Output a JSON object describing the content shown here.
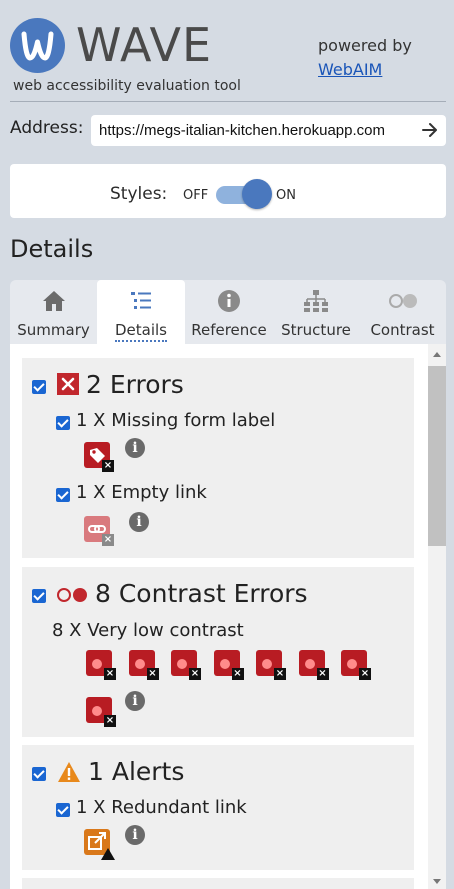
{
  "header": {
    "logo_text": "WAVE",
    "tagline": "web accessibility evaluation tool",
    "powered_by": "powered by",
    "webaim_link": "WebAIM"
  },
  "address": {
    "label": "Address:",
    "value": "https://megs-italian-kitchen.herokuapp.com"
  },
  "styles": {
    "label": "Styles:",
    "off": "OFF",
    "on": "ON",
    "state": "on"
  },
  "section_title": "Details",
  "tabs": [
    {
      "label": "Summary",
      "icon": "home-icon"
    },
    {
      "label": "Details",
      "icon": "list-icon",
      "active": true
    },
    {
      "label": "Reference",
      "icon": "info-icon"
    },
    {
      "label": "Structure",
      "icon": "structure-icon"
    },
    {
      "label": "Contrast",
      "icon": "contrast-icon"
    }
  ],
  "categories": {
    "errors": {
      "title": "2 Errors",
      "items": [
        {
          "label": "1 X Missing form label"
        },
        {
          "label": "1 X Empty link"
        }
      ]
    },
    "contrast": {
      "title": "8 Contrast Errors",
      "item_label": "8 X Very low contrast",
      "badge_count": 8
    },
    "alerts": {
      "title": "1 Alerts",
      "items": [
        {
          "label": "1 X Redundant link"
        }
      ]
    }
  },
  "colors": {
    "accent": "#4a78be",
    "error": "#b81c23",
    "alert": "#e8891c",
    "checkbox": "#1a66d2"
  }
}
